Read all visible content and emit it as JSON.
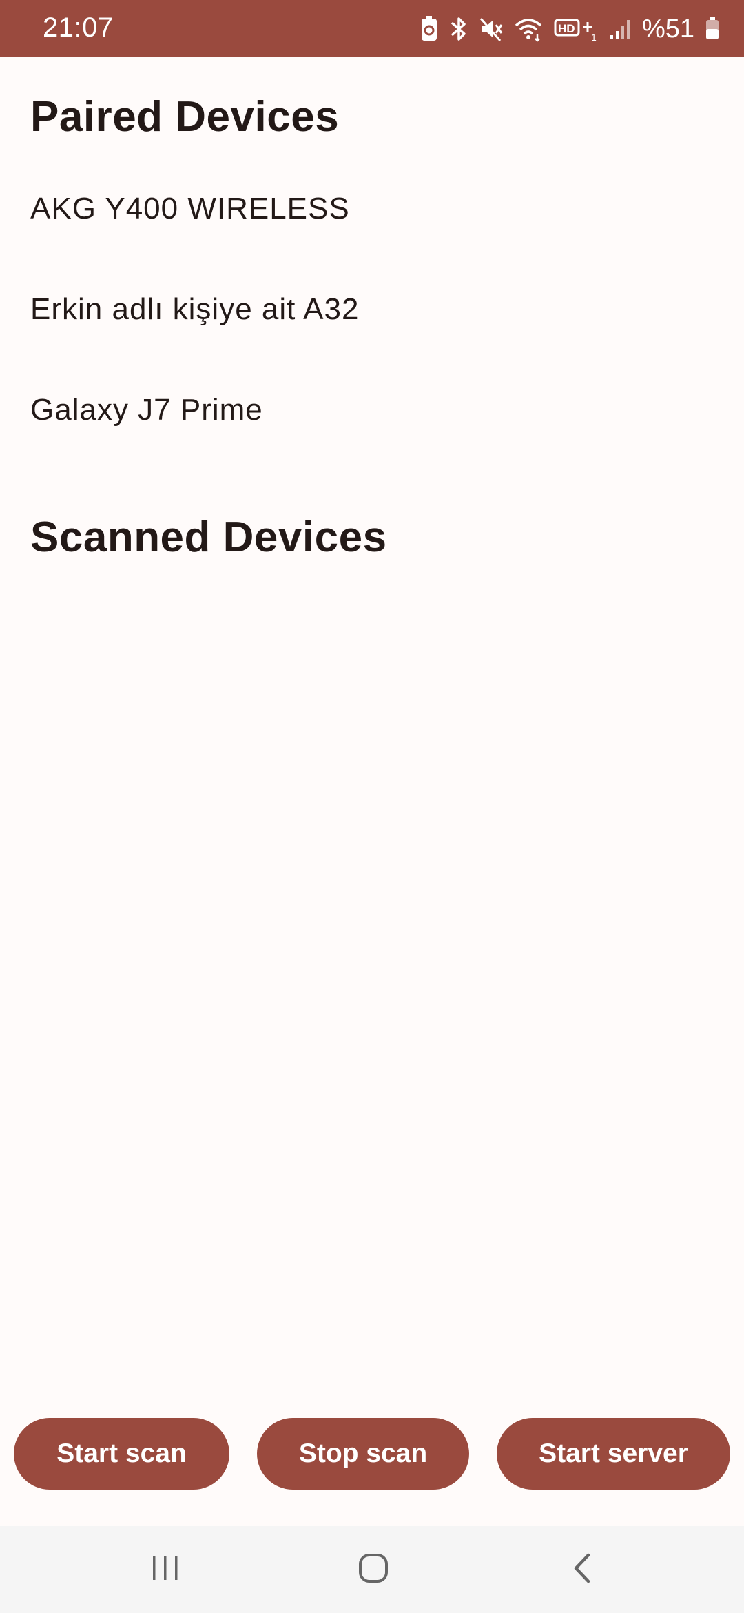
{
  "status_bar": {
    "time": "21:07",
    "battery_text": "%51",
    "background_color": "#9A4A3E",
    "icons": [
      "battery-saver-icon",
      "bluetooth-icon",
      "mute-icon",
      "wifi-icon",
      "hd-volte-icon",
      "signal-icon",
      "battery-icon"
    ]
  },
  "paired": {
    "title": "Paired Devices",
    "devices": [
      "AKG Y400 WIRELESS",
      "Erkin adlı kişiye ait A32",
      "Galaxy J7 Prime"
    ]
  },
  "scanned": {
    "title": "Scanned Devices",
    "devices": []
  },
  "actions": {
    "start_scan": "Start scan",
    "stop_scan": "Stop scan",
    "start_server": "Start server",
    "button_color": "#9A4A3E"
  },
  "nav": {
    "icons": [
      "recents-icon",
      "home-icon",
      "back-icon"
    ]
  }
}
